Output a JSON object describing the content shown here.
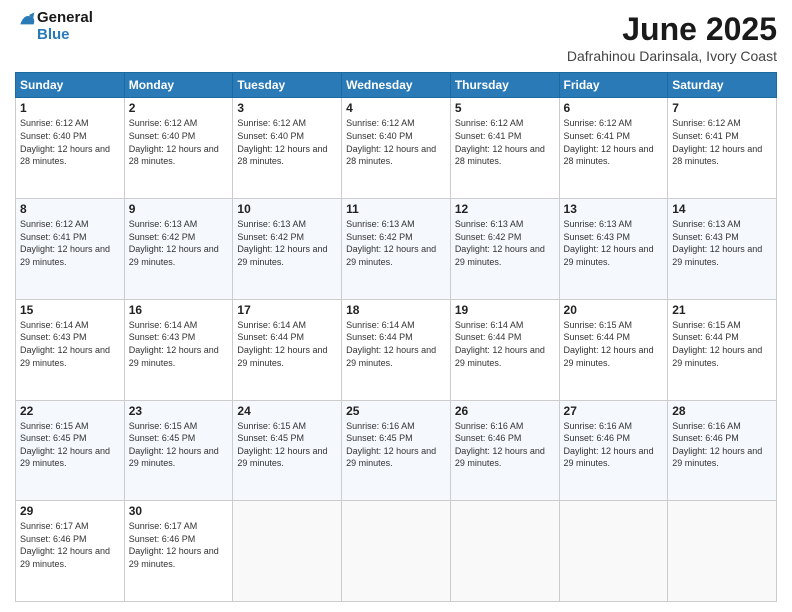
{
  "logo": {
    "line1": "General",
    "line2": "Blue"
  },
  "title": "June 2025",
  "subtitle": "Dafrahinou Darinsala, Ivory Coast",
  "header": {
    "days": [
      "Sunday",
      "Monday",
      "Tuesday",
      "Wednesday",
      "Thursday",
      "Friday",
      "Saturday"
    ]
  },
  "weeks": [
    [
      {
        "day": "1",
        "sunrise": "6:12 AM",
        "sunset": "6:40 PM",
        "daylight": "12 hours and 28 minutes."
      },
      {
        "day": "2",
        "sunrise": "6:12 AM",
        "sunset": "6:40 PM",
        "daylight": "12 hours and 28 minutes."
      },
      {
        "day": "3",
        "sunrise": "6:12 AM",
        "sunset": "6:40 PM",
        "daylight": "12 hours and 28 minutes."
      },
      {
        "day": "4",
        "sunrise": "6:12 AM",
        "sunset": "6:40 PM",
        "daylight": "12 hours and 28 minutes."
      },
      {
        "day": "5",
        "sunrise": "6:12 AM",
        "sunset": "6:41 PM",
        "daylight": "12 hours and 28 minutes."
      },
      {
        "day": "6",
        "sunrise": "6:12 AM",
        "sunset": "6:41 PM",
        "daylight": "12 hours and 28 minutes."
      },
      {
        "day": "7",
        "sunrise": "6:12 AM",
        "sunset": "6:41 PM",
        "daylight": "12 hours and 28 minutes."
      }
    ],
    [
      {
        "day": "8",
        "sunrise": "6:12 AM",
        "sunset": "6:41 PM",
        "daylight": "12 hours and 29 minutes."
      },
      {
        "day": "9",
        "sunrise": "6:13 AM",
        "sunset": "6:42 PM",
        "daylight": "12 hours and 29 minutes."
      },
      {
        "day": "10",
        "sunrise": "6:13 AM",
        "sunset": "6:42 PM",
        "daylight": "12 hours and 29 minutes."
      },
      {
        "day": "11",
        "sunrise": "6:13 AM",
        "sunset": "6:42 PM",
        "daylight": "12 hours and 29 minutes."
      },
      {
        "day": "12",
        "sunrise": "6:13 AM",
        "sunset": "6:42 PM",
        "daylight": "12 hours and 29 minutes."
      },
      {
        "day": "13",
        "sunrise": "6:13 AM",
        "sunset": "6:43 PM",
        "daylight": "12 hours and 29 minutes."
      },
      {
        "day": "14",
        "sunrise": "6:13 AM",
        "sunset": "6:43 PM",
        "daylight": "12 hours and 29 minutes."
      }
    ],
    [
      {
        "day": "15",
        "sunrise": "6:14 AM",
        "sunset": "6:43 PM",
        "daylight": "12 hours and 29 minutes."
      },
      {
        "day": "16",
        "sunrise": "6:14 AM",
        "sunset": "6:43 PM",
        "daylight": "12 hours and 29 minutes."
      },
      {
        "day": "17",
        "sunrise": "6:14 AM",
        "sunset": "6:44 PM",
        "daylight": "12 hours and 29 minutes."
      },
      {
        "day": "18",
        "sunrise": "6:14 AM",
        "sunset": "6:44 PM",
        "daylight": "12 hours and 29 minutes."
      },
      {
        "day": "19",
        "sunrise": "6:14 AM",
        "sunset": "6:44 PM",
        "daylight": "12 hours and 29 minutes."
      },
      {
        "day": "20",
        "sunrise": "6:15 AM",
        "sunset": "6:44 PM",
        "daylight": "12 hours and 29 minutes."
      },
      {
        "day": "21",
        "sunrise": "6:15 AM",
        "sunset": "6:44 PM",
        "daylight": "12 hours and 29 minutes."
      }
    ],
    [
      {
        "day": "22",
        "sunrise": "6:15 AM",
        "sunset": "6:45 PM",
        "daylight": "12 hours and 29 minutes."
      },
      {
        "day": "23",
        "sunrise": "6:15 AM",
        "sunset": "6:45 PM",
        "daylight": "12 hours and 29 minutes."
      },
      {
        "day": "24",
        "sunrise": "6:15 AM",
        "sunset": "6:45 PM",
        "daylight": "12 hours and 29 minutes."
      },
      {
        "day": "25",
        "sunrise": "6:16 AM",
        "sunset": "6:45 PM",
        "daylight": "12 hours and 29 minutes."
      },
      {
        "day": "26",
        "sunrise": "6:16 AM",
        "sunset": "6:46 PM",
        "daylight": "12 hours and 29 minutes."
      },
      {
        "day": "27",
        "sunrise": "6:16 AM",
        "sunset": "6:46 PM",
        "daylight": "12 hours and 29 minutes."
      },
      {
        "day": "28",
        "sunrise": "6:16 AM",
        "sunset": "6:46 PM",
        "daylight": "12 hours and 29 minutes."
      }
    ],
    [
      {
        "day": "29",
        "sunrise": "6:17 AM",
        "sunset": "6:46 PM",
        "daylight": "12 hours and 29 minutes."
      },
      {
        "day": "30",
        "sunrise": "6:17 AM",
        "sunset": "6:46 PM",
        "daylight": "12 hours and 29 minutes."
      },
      null,
      null,
      null,
      null,
      null
    ]
  ],
  "labels": {
    "sunrise": "Sunrise:",
    "sunset": "Sunset:",
    "daylight": "Daylight:"
  }
}
